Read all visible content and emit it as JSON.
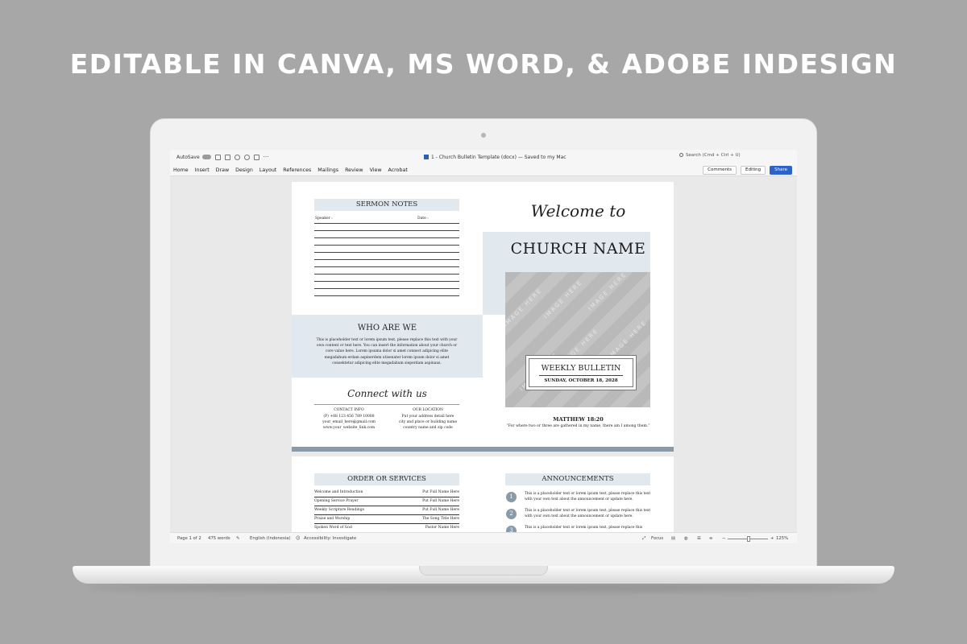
{
  "headline": "EDITABLE IN CANVA, MS WORD, & ADOBE INDESIGN",
  "titlebar": {
    "autosave_label": "AutoSave",
    "doc_title": "1 - Church Bulletin Template (docx) — Saved to my Mac",
    "search_placeholder": "Search (Cmd + Ctrl + U)"
  },
  "ribbon": {
    "tabs": [
      "Home",
      "Insert",
      "Draw",
      "Design",
      "Layout",
      "References",
      "Mailings",
      "Review",
      "View",
      "Acrobat"
    ],
    "comments": "Comments",
    "editing": "Editing",
    "share": "Share"
  },
  "page1": {
    "sermon_notes": {
      "title": "SERMON NOTES",
      "speaker_label": "Speaker :",
      "date_label": "Date :"
    },
    "who_are_we": {
      "title": "WHO ARE WE",
      "text": "This is placeholder text or lorem ipsum text, please replace this text with your own content or text here. You can insert the information about your church or core value here. Lorem ipsuma dolor si amet connect adipicing elite megadahum erdam aspinerdem utisenater lorem ipsum dolor si amet consektetur adipicing elite megadahum sieperdam aspinaus."
    },
    "connect": {
      "title": "Connect with us",
      "contact_heading": "CONTACT INFO",
      "contact_lines": [
        "(P) +88 123 456 789 10088",
        "your_email_here@gmail.com",
        "www.your_website_link.com"
      ],
      "location_heading": "OUR LOCATION",
      "location_lines": [
        "Put your address detail here",
        "city and place or building name",
        "country name and zip code"
      ]
    },
    "welcome": "Welcome to",
    "church_name": "CHURCH NAME",
    "image_placeholder": "IMAGE HERE",
    "weekly_bulletin": "WEEKLY BULLETIN",
    "bulletin_date": "SUNDAY, OCTOBER 18, 2028",
    "verse_ref": "MATTHEW 18:20",
    "verse_text": "“For where two or three are gathered in my name, there am I among them.”"
  },
  "page2": {
    "order_title": "ORDER OR SERVICES",
    "order_items": [
      {
        "item": "Welcome and Introduction",
        "who": "Put Full Name Here"
      },
      {
        "item": "Opening Service Prayer",
        "who": "Put Full Name Here"
      },
      {
        "item": "Weekly Scripture Readings",
        "who": "Put Full Name Here"
      },
      {
        "item": "Praise and Worship",
        "who": "The Song Title Here"
      },
      {
        "item": "Spoken Word of God",
        "who": "Pastor Name Here"
      }
    ],
    "announcements_title": "ANNOUNCEMENTS",
    "announcements": [
      {
        "num": "1",
        "text": "This is a placeholder text or lorem ipsum text, please replace this text with your own text about the announcement or update here."
      },
      {
        "num": "2",
        "text": "This is a placeholder text or lorem ipsum text, please replace this text with your own text about the announcement or update here."
      },
      {
        "num": "3",
        "text": "This is a placeholder text or lorem ipsum text, please replace this"
      }
    ]
  },
  "statusbar": {
    "page": "Page 1 of 2",
    "words": "475 words",
    "language": "English (Indonesia)",
    "accessibility": "Accessibility: Investigate",
    "focus": "Focus",
    "zoom": "125%",
    "zoom_fraction": 0.5
  }
}
